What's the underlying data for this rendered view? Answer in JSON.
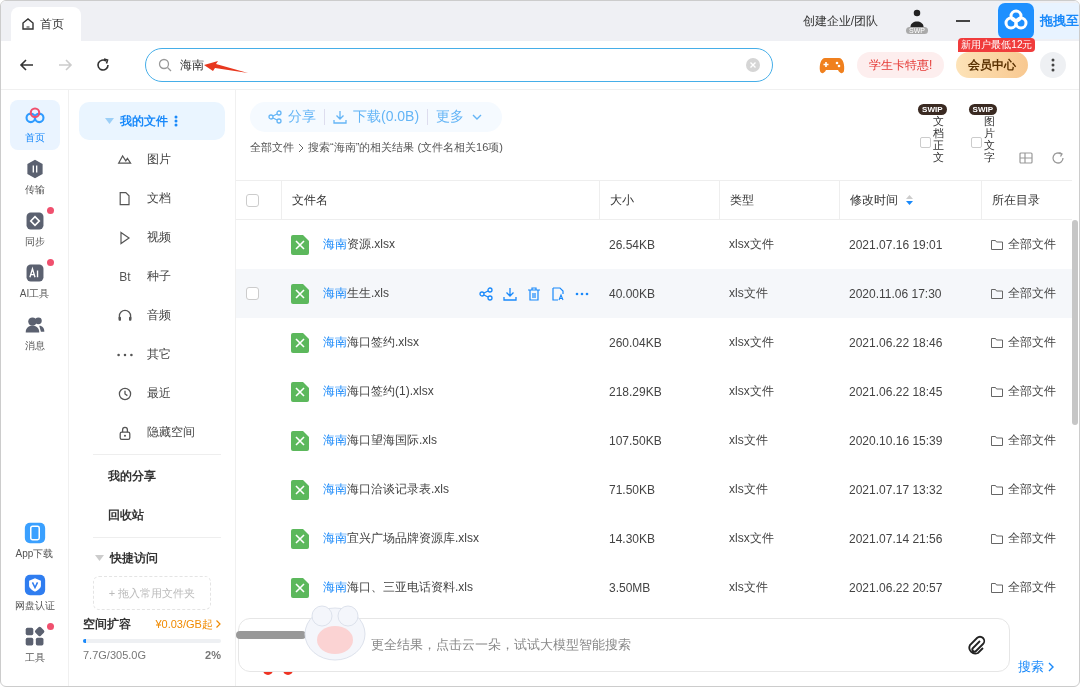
{
  "window": {
    "tab": {
      "label": "首页",
      "selected": true
    },
    "create_team": "创建企业/团队",
    "avatar_badge": "SWP",
    "drag_widget": "拖拽至"
  },
  "toolbar": {
    "back_disabled": false,
    "forward_disabled": true,
    "search": {
      "value": "海南"
    },
    "student_offer": "学生卡特惠!",
    "vip_badge": "新用户最低12元",
    "vip_button": "会员中心"
  },
  "rail": {
    "items": [
      {
        "label": "首页",
        "kind": "home",
        "selected": true,
        "badge": false
      },
      {
        "label": "传输",
        "kind": "transfer",
        "selected": false,
        "badge": false
      },
      {
        "label": "同步",
        "kind": "sync",
        "selected": false,
        "badge": true
      },
      {
        "label": "AI工具",
        "kind": "ai",
        "selected": false,
        "badge": true
      },
      {
        "label": "消息",
        "kind": "message",
        "selected": false,
        "badge": false
      }
    ],
    "bottom_items": [
      {
        "label": "App下载",
        "kind": "app",
        "badge": false
      },
      {
        "label": "网盘认证",
        "kind": "verify",
        "badge": false
      },
      {
        "label": "工具",
        "kind": "tools",
        "badge": true
      }
    ]
  },
  "nav": {
    "my_files": {
      "label": "我的文件",
      "expanded": true,
      "selected": true
    },
    "categories": [
      {
        "label": "图片",
        "kind": "image"
      },
      {
        "label": "文档",
        "kind": "doc"
      },
      {
        "label": "视频",
        "kind": "video"
      },
      {
        "label": "种子",
        "kind": "bt",
        "icon_text": "Bt"
      },
      {
        "label": "音频",
        "kind": "audio"
      },
      {
        "label": "其它",
        "kind": "other"
      },
      {
        "label": "最近",
        "kind": "recent"
      },
      {
        "label": "隐藏空间",
        "kind": "lock"
      }
    ],
    "links": [
      "我的分享",
      "回收站"
    ],
    "quick_access": {
      "label": "快捷访问",
      "expanded": true,
      "drop_hint": "+ 拖入常用文件夹"
    },
    "storage": {
      "label": "空间扩容",
      "price": "¥0.03/GB起",
      "level": 0.025,
      "usage": "7.7G/305.0G",
      "percent": "2%"
    }
  },
  "actions": [
    "分享",
    "下载(0.0B)",
    "更多"
  ],
  "breadcrumb": {
    "root": "全部文件",
    "current": "搜索“海南”的相关结果 (文件名相关16项)"
  },
  "options": [
    {
      "badge": "SWIP",
      "label": "文档正文",
      "checked": false
    },
    {
      "badge": "SWIP",
      "label": "图片文字",
      "checked": false
    }
  ],
  "select_all": {
    "checked": false
  },
  "table": {
    "columns": [
      "文件名",
      "大小",
      "类型",
      "修改时间",
      "所在目录"
    ],
    "rows": [
      {
        "match": "海南",
        "rest": "资源.xlsx",
        "size": "26.54KB",
        "type": "xlsx文件",
        "modified": "2021.07.16 19:01",
        "folder": "全部文件",
        "hovered": false
      },
      {
        "match": "海南",
        "rest": "生生.xls",
        "size": "40.00KB",
        "type": "xls文件",
        "modified": "2020.11.06 17:30",
        "folder": "全部文件",
        "hovered": true
      },
      {
        "match": "海南",
        "rest": "海口签约.xlsx",
        "size": "260.04KB",
        "type": "xlsx文件",
        "modified": "2021.06.22 18:46",
        "folder": "全部文件",
        "hovered": false
      },
      {
        "match": "海南",
        "rest": "海口签约(1).xlsx",
        "size": "218.29KB",
        "type": "xlsx文件",
        "modified": "2021.06.22 18:45",
        "folder": "全部文件",
        "hovered": false
      },
      {
        "match": "海南",
        "rest": "海口望海国际.xls",
        "size": "107.50KB",
        "type": "xls文件",
        "modified": "2020.10.16 15:39",
        "folder": "全部文件",
        "hovered": false
      },
      {
        "match": "海南",
        "rest": "海口洽谈记录表.xls",
        "size": "71.50KB",
        "type": "xls文件",
        "modified": "2021.07.17 13:32",
        "folder": "全部文件",
        "hovered": false
      },
      {
        "match": "海南",
        "rest": "宜兴广场品牌资源库.xlsx",
        "size": "14.30KB",
        "type": "xlsx文件",
        "modified": "2021.07.14 21:56",
        "folder": "全部文件",
        "hovered": false
      },
      {
        "match": "海南",
        "rest": "海口、三亚电话资料.xls",
        "size": "3.50MB",
        "type": "xls文件",
        "modified": "2021.06.22 20:57",
        "folder": "全部文件",
        "hovered": false
      }
    ]
  },
  "ai_search": {
    "placeholder": "更全结果，点击云一朵，试试大模型智能搜索"
  },
  "footer_link": "搜索"
}
